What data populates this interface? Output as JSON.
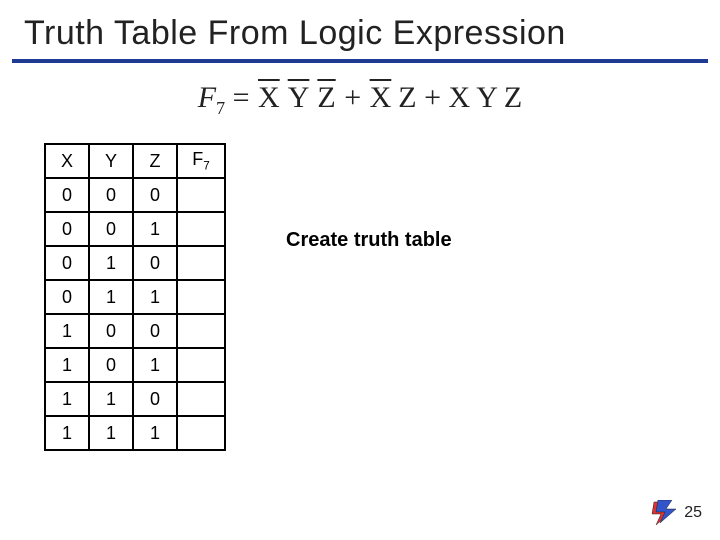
{
  "title": "Truth Table From Logic Expression",
  "equation": {
    "lhs_var": "F",
    "lhs_sub": "7",
    "eq_sign": " = ",
    "plus": " + ",
    "t1": {
      "a": "X",
      "b": "Y",
      "c": "Z"
    },
    "t2": {
      "a": "X",
      "b": "Z"
    },
    "t3": {
      "a": "X",
      "b": "Y",
      "c": "Z"
    }
  },
  "instruction": "Create truth table",
  "page_number": "25",
  "table": {
    "headers": [
      "X",
      "Y",
      "Z"
    ],
    "fcol_var": "F",
    "fcol_sub": "7",
    "rows": [
      [
        "0",
        "0",
        "0",
        ""
      ],
      [
        "0",
        "0",
        "1",
        ""
      ],
      [
        "0",
        "1",
        "0",
        ""
      ],
      [
        "0",
        "1",
        "1",
        ""
      ],
      [
        "1",
        "0",
        "0",
        ""
      ],
      [
        "1",
        "0",
        "1",
        ""
      ],
      [
        "1",
        "1",
        "0",
        ""
      ],
      [
        "1",
        "1",
        "1",
        ""
      ]
    ]
  },
  "chart_data": {
    "type": "table",
    "title": "Truth Table From Logic Expression",
    "columns": [
      "X",
      "Y",
      "Z",
      "F7"
    ],
    "rows": [
      [
        0,
        0,
        0,
        null
      ],
      [
        0,
        0,
        1,
        null
      ],
      [
        0,
        1,
        0,
        null
      ],
      [
        0,
        1,
        1,
        null
      ],
      [
        1,
        0,
        0,
        null
      ],
      [
        1,
        0,
        1,
        null
      ],
      [
        1,
        1,
        0,
        null
      ],
      [
        1,
        1,
        1,
        null
      ]
    ]
  }
}
